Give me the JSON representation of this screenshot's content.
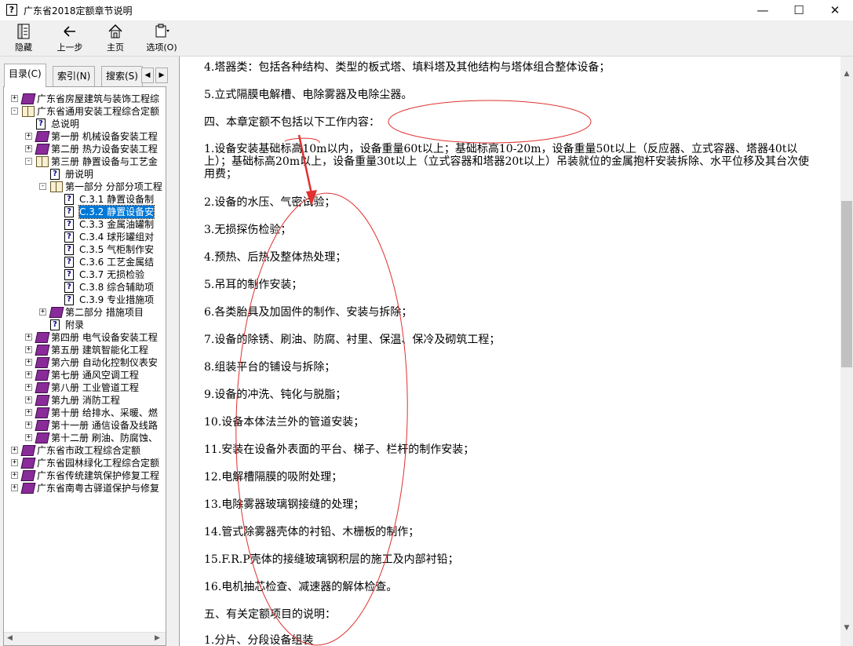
{
  "window": {
    "title": "广东省2018定额章节说明",
    "controls": {
      "minimize": "—",
      "maximize": "☐",
      "close": "✕"
    }
  },
  "toolbar": {
    "hide_label": "隐藏",
    "back_label": "上一步",
    "home_label": "主页",
    "options_label": "选项(O)"
  },
  "tabs": {
    "contents": "目录(C)",
    "index": "索引(N)",
    "search": "搜索(S)"
  },
  "tree": [
    {
      "text": "广东省房屋建筑与装饰工程综",
      "icon": "book-closed",
      "expander": "+"
    },
    {
      "text": "广东省通用安装工程综合定额",
      "icon": "book-open",
      "expander": "-"
    },
    {
      "text": "总说明",
      "icon": "help-page"
    },
    {
      "text": "第一册 机械设备安装工程",
      "icon": "book-closed",
      "expander": "+"
    },
    {
      "text": "第二册 热力设备安装工程",
      "icon": "book-closed",
      "expander": "+"
    },
    {
      "text": "第三册 静置设备与工艺金",
      "icon": "book-open",
      "expander": "-"
    },
    {
      "text": "册说明",
      "icon": "help-page"
    },
    {
      "text": "第一部分 分部分项工程",
      "icon": "book-open",
      "expander": "-"
    },
    {
      "text": "C.3.1 静置设备制",
      "icon": "help-page"
    },
    {
      "text": "C.3.2 静置设备安",
      "icon": "help-page",
      "selected": true
    },
    {
      "text": "C.3.3 金属油罐制",
      "icon": "help-page"
    },
    {
      "text": "C.3.4 球形罐组对",
      "icon": "help-page"
    },
    {
      "text": "C.3.5 气柜制作安",
      "icon": "help-page"
    },
    {
      "text": "C.3.6 工艺金属结",
      "icon": "help-page"
    },
    {
      "text": "C.3.7 无损检验",
      "icon": "help-page"
    },
    {
      "text": "C.3.8 综合辅助项",
      "icon": "help-page"
    },
    {
      "text": "C.3.9 专业措施项",
      "icon": "help-page"
    },
    {
      "text": "第二部分 措施项目",
      "icon": "book-closed",
      "expander": "+"
    },
    {
      "text": "附录",
      "icon": "help-page"
    },
    {
      "text": "第四册 电气设备安装工程",
      "icon": "book-closed",
      "expander": "+"
    },
    {
      "text": "第五册 建筑智能化工程",
      "icon": "book-closed",
      "expander": "+"
    },
    {
      "text": "第六册 自动化控制仪表安",
      "icon": "book-closed",
      "expander": "+"
    },
    {
      "text": "第七册 通风空调工程",
      "icon": "book-closed",
      "expander": "+"
    },
    {
      "text": "第八册 工业管道工程",
      "icon": "book-closed",
      "expander": "+"
    },
    {
      "text": "第九册 消防工程",
      "icon": "book-closed",
      "expander": "+"
    },
    {
      "text": "第十册 给排水、采暖、燃",
      "icon": "book-closed",
      "expander": "+"
    },
    {
      "text": "第十一册 通信设备及线路",
      "icon": "book-closed",
      "expander": "+"
    },
    {
      "text": "第十二册 刷油、防腐蚀、",
      "icon": "book-closed",
      "expander": "+"
    },
    {
      "text": "广东省市政工程综合定额",
      "icon": "book-closed",
      "expander": "+"
    },
    {
      "text": "广东省园林绿化工程综合定额",
      "icon": "book-closed",
      "expander": "+"
    },
    {
      "text": "广东省传统建筑保护修复工程",
      "icon": "book-closed",
      "expander": "+"
    },
    {
      "text": "广东省南粤古驿道保护与修复",
      "icon": "book-closed",
      "expander": "+"
    }
  ],
  "content": {
    "paragraphs": [
      "4.塔器类：包括各种结构、类型的板式塔、填料塔及其他结构与塔体组合整体设备；",
      "5.立式隔膜电解槽、电除雾器及电除尘器。",
      "四、本章定额不包括以下工作内容：",
      "1.设备安装基础标高10m以内，设备重量60t以上；基础标高10-20m，设备重量50t以上（反应器、立式容器、塔器40t以上）；基础标高20m以上，设备重量30t以上（立式容器和塔器20t以上）吊装就位的金属抱杆安装拆除、水平位移及其台次使用费；",
      "2.设备的水压、气密试验；",
      "3.无损探伤检验；",
      "4.预热、后热及整体热处理；",
      "5.吊耳的制作安装；",
      "6.各类胎具及加固件的制作、安装与拆除；",
      "7.设备的除锈、刷油、防腐、衬里、保温、保冷及砌筑工程；",
      "8.组装平台的铺设与拆除；",
      "9.设备的冲洗、钝化与脱脂；",
      "10.设备本体法兰外的管道安装；",
      "11.安装在设备外表面的平台、梯子、栏杆的制作安装；",
      "12.电解槽隔膜的吸附处理；",
      "13.电除雾器玻璃钢接缝的处理；",
      "14.管式除雾器壳体的衬铅、木栅板的制作；",
      "15.F.R.P壳体的接缝玻璃钢积层的施工及内部衬铅；",
      "16.电机抽芯检查、减速器的解体检查。",
      "五、有关定额项目的说明：",
      "1.分片、分段设备组装"
    ]
  },
  "colors": {
    "annotation": "#e03030",
    "selection": "#0078d7",
    "book": "#8a2b9a"
  }
}
